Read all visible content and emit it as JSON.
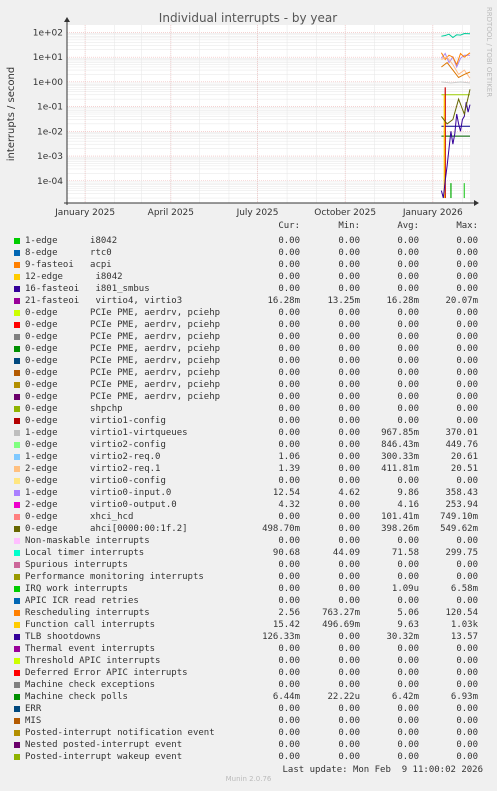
{
  "chart_data": {
    "type": "line",
    "title": "Individual interrupts - by year",
    "ylabel": "interrupts / second",
    "yscale": "log",
    "ylim": [
      1e-05,
      200
    ],
    "yticks": [
      "1e+02",
      "1e+01",
      "1e+00",
      "1e-01",
      "1e-02",
      "1e-03",
      "1e-04"
    ],
    "xticks": [
      "January 2025",
      "April 2025",
      "July 2025",
      "October 2025",
      "January 2026"
    ],
    "xlim": [
      "2024-12-13",
      "2026-02-09"
    ],
    "grid": true,
    "watermark": "RRDTOOL / TOBI OETIKER",
    "series_data": [
      {
        "name": "Local timer interrupts",
        "color": "#00CC99",
        "x": [
          "2026-01-10",
          "2026-01-14",
          "2026-01-18",
          "2026-01-22",
          "2026-01-26",
          "2026-01-30",
          "2026-02-03",
          "2026-02-09"
        ],
        "y": [
          70,
          75,
          85,
          62,
          80,
          78,
          90,
          88
        ]
      },
      {
        "name": "virtio0-input.0",
        "color": "#AA88EE",
        "x": [
          "2026-01-10",
          "2026-01-14",
          "2026-01-18",
          "2026-01-22",
          "2026-01-26",
          "2026-01-30",
          "2026-02-03",
          "2026-02-09"
        ],
        "y": [
          9,
          14,
          6,
          10,
          4,
          9,
          12,
          12
        ]
      },
      {
        "name": "Function call interrupts",
        "color": "#FF8000",
        "x": [
          "2026-01-10",
          "2026-01-14",
          "2026-01-18",
          "2026-01-22",
          "2026-01-26",
          "2026-01-30",
          "2026-02-03",
          "2026-02-09"
        ],
        "y": [
          15,
          8,
          12,
          10,
          5,
          14,
          10,
          15
        ]
      },
      {
        "name": "2-edge virtio2-req.1",
        "color": "#FFBB88",
        "x": [
          "2026-01-10",
          "2026-01-16",
          "2026-01-22",
          "2026-01-28",
          "2026-02-03",
          "2026-02-09"
        ],
        "y": [
          8,
          10,
          5,
          2,
          3,
          1.4
        ]
      },
      {
        "name": "Rescheduling interrupts",
        "color": "#DD7700",
        "x": [
          "2026-01-10",
          "2026-01-16",
          "2026-01-22",
          "2026-01-28",
          "2026-02-03",
          "2026-02-09"
        ],
        "y": [
          4,
          6,
          3,
          1.5,
          2,
          2.5
        ]
      },
      {
        "name": "TLB shootdowns",
        "color": "#330099",
        "x": [
          "2026-01-10",
          "2026-01-12",
          "2026-01-14",
          "2026-01-16",
          "2026-01-18",
          "2026-01-20",
          "2026-01-22",
          "2026-01-24",
          "2026-01-26",
          "2026-01-28",
          "2026-01-30",
          "2026-02-01",
          "2026-02-03",
          "2026-02-05",
          "2026-02-07",
          "2026-02-09"
        ],
        "y": [
          4e-05,
          2e-05,
          0.0001,
          0.0004,
          0.002,
          0.01,
          0.003,
          0.008,
          0.05,
          0.02,
          0.01,
          0.03,
          0.04,
          0.15,
          0.06,
          0.12
        ]
      },
      {
        "name": "ahci[0000:00:1f.2]",
        "color": "#666600",
        "x": [
          "2026-01-10",
          "2026-01-16",
          "2026-01-22",
          "2026-01-28",
          "2026-02-03",
          "2026-02-09"
        ],
        "y": [
          0.04,
          0.02,
          0.03,
          0.2,
          0.05,
          0.5
        ]
      },
      {
        "name": "1-edge virtio1-virtqueues",
        "color": "#CCCCCC",
        "x": [
          "2026-01-10",
          "2026-01-20",
          "2026-01-30",
          "2026-02-09"
        ],
        "y": [
          1,
          0.9,
          1,
          0.9
        ]
      }
    ],
    "spikes": [
      {
        "color": "#CC0000",
        "date": "2026-01-14",
        "from": 2e-05,
        "to": 0.6
      },
      {
        "color": "#FFCC00",
        "date": "2026-01-13",
        "from": 2e-05,
        "to": 0.3
      },
      {
        "color": "#00AA00",
        "date": "2026-01-20",
        "from": 2e-05,
        "to": 8e-05
      },
      {
        "color": "#33CC33",
        "date": "2026-02-03",
        "from": 2e-05,
        "to": 8e-05
      }
    ],
    "flat_lines": [
      {
        "color": "#000088",
        "date_from": "2026-01-10",
        "date_to": "2026-02-09",
        "value": 0.016
      },
      {
        "color": "#006600",
        "date_from": "2026-01-10",
        "date_to": "2026-02-09",
        "value": 0.0064
      },
      {
        "color": "#99CC00",
        "date_from": "2026-01-10",
        "date_to": "2026-02-09",
        "value": 0.3
      }
    ],
    "columns": [
      "Cur:",
      "Min:",
      "Avg:",
      "Max:"
    ],
    "legend": [
      {
        "color": "#00CC00",
        "name": "1-edge      i8042",
        "cur": "0.00",
        "min": "0.00",
        "avg": "0.00",
        "max": "0.00"
      },
      {
        "color": "#0066B3",
        "name": "8-edge      rtc0",
        "cur": "0.00",
        "min": "0.00",
        "avg": "0.00",
        "max": "0.00"
      },
      {
        "color": "#FF8000",
        "name": "9-fasteoi   acpi",
        "cur": "0.00",
        "min": "0.00",
        "avg": "0.00",
        "max": "0.00"
      },
      {
        "color": "#FFCC00",
        "name": "12-edge      i8042",
        "cur": "0.00",
        "min": "0.00",
        "avg": "0.00",
        "max": "0.00"
      },
      {
        "color": "#330099",
        "name": "16-fasteoi   i801_smbus",
        "cur": "0.00",
        "min": "0.00",
        "avg": "0.00",
        "max": "0.00"
      },
      {
        "color": "#990099",
        "name": "21-fasteoi   virtio4, virtio3",
        "cur": "16.28m",
        "min": "13.25m",
        "avg": "16.28m",
        "max": "20.07m"
      },
      {
        "color": "#CCFF00",
        "name": "0-edge      PCIe PME, aerdrv, pciehp",
        "cur": "0.00",
        "min": "0.00",
        "avg": "0.00",
        "max": "0.00"
      },
      {
        "color": "#FF0000",
        "name": "0-edge      PCIe PME, aerdrv, pciehp",
        "cur": "0.00",
        "min": "0.00",
        "avg": "0.00",
        "max": "0.00"
      },
      {
        "color": "#808080",
        "name": "0-edge      PCIe PME, aerdrv, pciehp",
        "cur": "0.00",
        "min": "0.00",
        "avg": "0.00",
        "max": "0.00"
      },
      {
        "color": "#008F00",
        "name": "0-edge      PCIe PME, aerdrv, pciehp",
        "cur": "0.00",
        "min": "0.00",
        "avg": "0.00",
        "max": "0.00"
      },
      {
        "color": "#00487D",
        "name": "0-edge      PCIe PME, aerdrv, pciehp",
        "cur": "0.00",
        "min": "0.00",
        "avg": "0.00",
        "max": "0.00"
      },
      {
        "color": "#B35A00",
        "name": "0-edge      PCIe PME, aerdrv, pciehp",
        "cur": "0.00",
        "min": "0.00",
        "avg": "0.00",
        "max": "0.00"
      },
      {
        "color": "#B38F00",
        "name": "0-edge      PCIe PME, aerdrv, pciehp",
        "cur": "0.00",
        "min": "0.00",
        "avg": "0.00",
        "max": "0.00"
      },
      {
        "color": "#6B006B",
        "name": "0-edge      PCIe PME, aerdrv, pciehp",
        "cur": "0.00",
        "min": "0.00",
        "avg": "0.00",
        "max": "0.00"
      },
      {
        "color": "#8FB300",
        "name": "0-edge      shpchp",
        "cur": "0.00",
        "min": "0.00",
        "avg": "0.00",
        "max": "0.00"
      },
      {
        "color": "#B30000",
        "name": "0-edge      virtio1-config",
        "cur": "0.00",
        "min": "0.00",
        "avg": "0.00",
        "max": "0.00"
      },
      {
        "color": "#BEBEBE",
        "name": "1-edge      virtio1-virtqueues",
        "cur": "0.00",
        "min": "0.00",
        "avg": "967.85m",
        "max": "370.01"
      },
      {
        "color": "#80FF80",
        "name": "0-edge      virtio2-config",
        "cur": "0.00",
        "min": "0.00",
        "avg": "846.43m",
        "max": "449.76"
      },
      {
        "color": "#80C9FF",
        "name": "1-edge      virtio2-req.0",
        "cur": "1.06",
        "min": "0.00",
        "avg": "300.33m",
        "max": "20.61"
      },
      {
        "color": "#FFC080",
        "name": "2-edge      virtio2-req.1",
        "cur": "1.39",
        "min": "0.00",
        "avg": "411.81m",
        "max": "20.51"
      },
      {
        "color": "#FFE680",
        "name": "0-edge      virtio0-config",
        "cur": "0.00",
        "min": "0.00",
        "avg": "0.00",
        "max": "0.00"
      },
      {
        "color": "#AA80FF",
        "name": "1-edge      virtio0-input.0",
        "cur": "12.54",
        "min": "4.62",
        "avg": "9.86",
        "max": "358.43"
      },
      {
        "color": "#EE00CC",
        "name": "2-edge      virtio0-output.0",
        "cur": "4.32",
        "min": "0.00",
        "avg": "4.16",
        "max": "253.94"
      },
      {
        "color": "#FF8080",
        "name": "0-edge      xhci_hcd",
        "cur": "0.00",
        "min": "0.00",
        "avg": "101.41m",
        "max": "749.10m"
      },
      {
        "color": "#666600",
        "name": "0-edge      ahci[0000:00:1f.2]",
        "cur": "498.70m",
        "min": "0.00",
        "avg": "398.26m",
        "max": "549.62m"
      },
      {
        "color": "#FFBFFF",
        "name": "Non-maskable interrupts",
        "cur": "0.00",
        "min": "0.00",
        "avg": "0.00",
        "max": "0.00"
      },
      {
        "color": "#00FFCC",
        "name": "Local timer interrupts",
        "cur": "90.68",
        "min": "44.09",
        "avg": "71.58",
        "max": "299.75"
      },
      {
        "color": "#CC6699",
        "name": "Spurious interrupts",
        "cur": "0.00",
        "min": "0.00",
        "avg": "0.00",
        "max": "0.00"
      },
      {
        "color": "#999900",
        "name": "Performance monitoring interrupts",
        "cur": "0.00",
        "min": "0.00",
        "avg": "0.00",
        "max": "0.00"
      },
      {
        "color": "#00CC00",
        "name": "IRQ work interrupts",
        "cur": "0.00",
        "min": "0.00",
        "avg": "1.09u",
        "max": "6.58m"
      },
      {
        "color": "#0066B3",
        "name": "APIC ICR read retries",
        "cur": "0.00",
        "min": "0.00",
        "avg": "0.00",
        "max": "0.00"
      },
      {
        "color": "#FF8000",
        "name": "Rescheduling interrupts",
        "cur": "2.56",
        "min": "763.27m",
        "avg": "5.06",
        "max": "120.54"
      },
      {
        "color": "#FFCC00",
        "name": "Function call interrupts",
        "cur": "15.42",
        "min": "496.69m",
        "avg": "9.63",
        "max": "1.03k"
      },
      {
        "color": "#330099",
        "name": "TLB shootdowns",
        "cur": "126.33m",
        "min": "0.00",
        "avg": "30.32m",
        "max": "13.57"
      },
      {
        "color": "#990099",
        "name": "Thermal event interrupts",
        "cur": "0.00",
        "min": "0.00",
        "avg": "0.00",
        "max": "0.00"
      },
      {
        "color": "#CCFF00",
        "name": "Threshold APIC interrupts",
        "cur": "0.00",
        "min": "0.00",
        "avg": "0.00",
        "max": "0.00"
      },
      {
        "color": "#FF0000",
        "name": "Deferred Error APIC interrupts",
        "cur": "0.00",
        "min": "0.00",
        "avg": "0.00",
        "max": "0.00"
      },
      {
        "color": "#808080",
        "name": "Machine check exceptions",
        "cur": "0.00",
        "min": "0.00",
        "avg": "0.00",
        "max": "0.00"
      },
      {
        "color": "#008F00",
        "name": "Machine check polls",
        "cur": "6.44m",
        "min": "22.22u",
        "avg": "6.42m",
        "max": "6.93m"
      },
      {
        "color": "#00487D",
        "name": "ERR",
        "cur": "0.00",
        "min": "0.00",
        "avg": "0.00",
        "max": "0.00"
      },
      {
        "color": "#B35A00",
        "name": "MIS",
        "cur": "0.00",
        "min": "0.00",
        "avg": "0.00",
        "max": "0.00"
      },
      {
        "color": "#B38F00",
        "name": "Posted-interrupt notification event",
        "cur": "0.00",
        "min": "0.00",
        "avg": "0.00",
        "max": "0.00"
      },
      {
        "color": "#6B006B",
        "name": "Nested posted-interrupt event",
        "cur": "0.00",
        "min": "0.00",
        "avg": "0.00",
        "max": "0.00"
      },
      {
        "color": "#8FB300",
        "name": "Posted-interrupt wakeup event",
        "cur": "0.00",
        "min": "0.00",
        "avg": "0.00",
        "max": "0.00"
      }
    ]
  },
  "last_update": "Last update: Mon Feb  9 11:00:02 2026",
  "credit": "Munin 2.0.76"
}
